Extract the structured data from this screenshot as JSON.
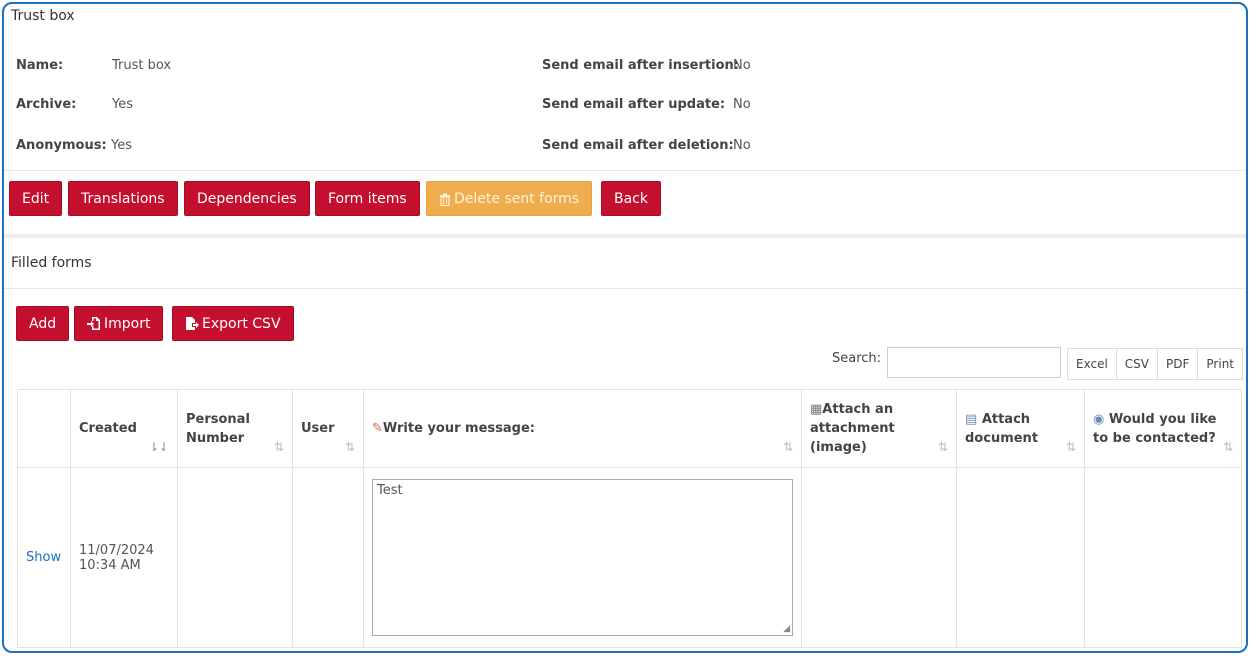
{
  "page": {
    "title": "Trust box"
  },
  "details": {
    "name_label": "Name:",
    "name_value": "Trust box",
    "archive_label": "Archive:",
    "archive_value": "Yes",
    "anonymous_label": "Anonymous:",
    "anonymous_value": "Yes",
    "email_insert_label": "Send email after insertion:",
    "email_insert_value": "No",
    "email_update_label": "Send email after update:",
    "email_update_value": "No",
    "email_delete_label": "Send email after deletion:",
    "email_delete_value": "No"
  },
  "actions": {
    "edit": "Edit",
    "translations": "Translations",
    "dependencies": "Dependencies",
    "form_items": "Form items",
    "delete_sent": "Delete sent forms",
    "back": "Back"
  },
  "filled_forms": {
    "title": "Filled forms",
    "add": "Add",
    "import": "Import",
    "export_csv": "Export CSV",
    "search_label": "Search:",
    "search_value": "",
    "export_buttons": [
      "Excel",
      "CSV",
      "PDF",
      "Print"
    ],
    "columns": {
      "created": "Created",
      "personal_number": "Personal Number",
      "user": "User",
      "message": "Write your message:",
      "attachment_image": "Attach an attachment (image)",
      "attach_document": "Attach document",
      "contacted": "Would you like to be contacted?"
    },
    "rows": [
      {
        "show": "Show",
        "created_date": "11/07/2024",
        "created_time": "10:34 AM",
        "personal_number": "",
        "user": "",
        "message": "Test",
        "attachment_image": "",
        "attach_document": "",
        "contacted": ""
      }
    ]
  },
  "colors": {
    "primary": "#c4102e",
    "warning": "#f0ad4e",
    "frame": "#1c6fc3",
    "link": "#1c6fc3"
  }
}
